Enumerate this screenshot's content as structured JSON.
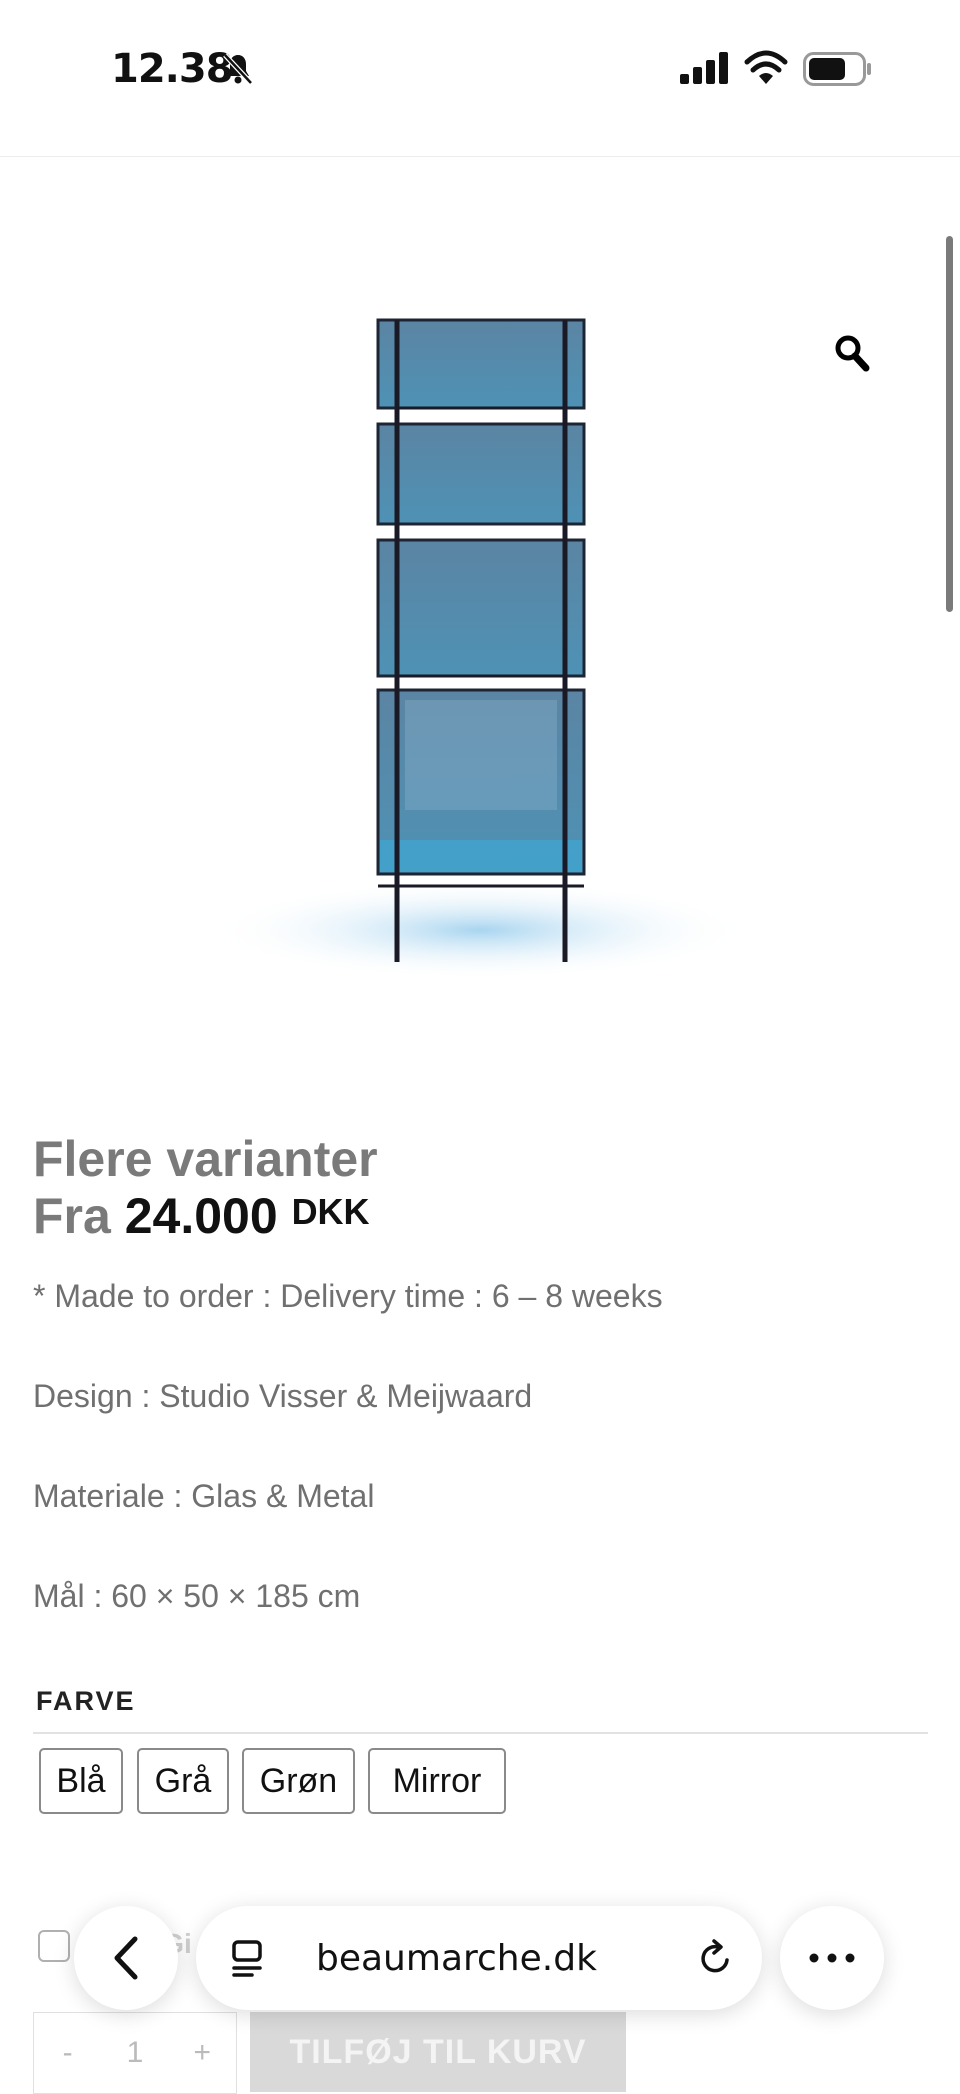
{
  "status": {
    "time": "12.38"
  },
  "product": {
    "title": "Flere varianter",
    "price_prefix": "Fra",
    "price": "24.000",
    "currency": "DKK",
    "details": [
      "* Made to order : Delivery time : 6 – 8 weeks",
      "Design : Studio Visser & Meijwaard",
      "Materiale : Glas & Metal",
      "Mål : 60 × 50 × 185 cm"
    ]
  },
  "variants": {
    "label": "FARVE",
    "options": [
      "Blå",
      "Grå",
      "Grøn",
      "Mirror"
    ]
  },
  "gift": {
    "label": "Add Gi"
  },
  "cart": {
    "qty_minus": "-",
    "qty": "1",
    "qty_plus": "+",
    "add_label": "TILFØJ TIL KURV"
  },
  "browser": {
    "url": "beaumarche.dk"
  }
}
